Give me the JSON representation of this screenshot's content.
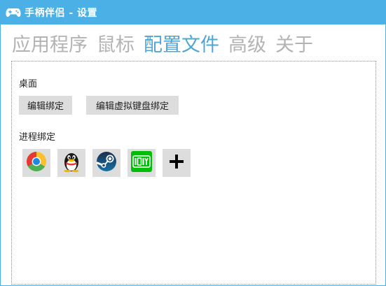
{
  "window": {
    "title": "手柄伴侣 - 设置",
    "title_icon": "gamepad-icon",
    "accent_color": "#4ab0e6"
  },
  "tabs": [
    {
      "label": "应用程序",
      "active": false
    },
    {
      "label": "鼠标",
      "active": false
    },
    {
      "label": "配置文件",
      "active": true
    },
    {
      "label": "高级",
      "active": false
    },
    {
      "label": "关于",
      "active": false
    }
  ],
  "desktop": {
    "heading": "桌面",
    "edit_binding_label": "编辑绑定",
    "edit_virtual_keyboard_label": "编辑虚拟键盘绑定"
  },
  "process_binding": {
    "heading": "进程绑定",
    "apps": [
      {
        "icon": "chrome-icon"
      },
      {
        "icon": "qq-icon"
      },
      {
        "icon": "steam-icon"
      },
      {
        "icon": "iqiyi-icon"
      }
    ],
    "add_icon": "plus-icon"
  }
}
